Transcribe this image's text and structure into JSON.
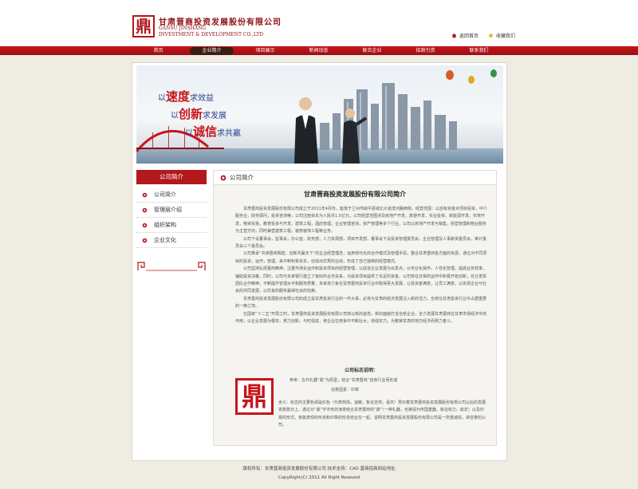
{
  "header": {
    "logo_char": "鼎",
    "company_cn": "甘肃晋商投资发展股份有限公司",
    "company_en_line1": "GANSU JINSHANG",
    "company_en_line2": "INVESTMENT & DEVELOPMENT CO.,LTD",
    "home_link": "返回首页",
    "favorite_link": "收藏我们"
  },
  "nav": {
    "items": [
      "首页",
      "企业简介",
      "项目展示",
      "新闻动态",
      "联合企业",
      "招商引资",
      "联系我们"
    ],
    "active_index": 1
  },
  "banner": {
    "slogan1_a": "以",
    "slogan1_big": "速度",
    "slogan1_b": "求效益",
    "slogan2_a": "以",
    "slogan2_big": "创新",
    "slogan2_b": "求发展",
    "slogan3_a": "以",
    "slogan3_big": "诚信",
    "slogan3_b": "求共赢"
  },
  "sidebar": {
    "title": "公司简介",
    "items": [
      {
        "label": "公司简介"
      },
      {
        "label": "管理层介绍"
      },
      {
        "label": "组织架构"
      },
      {
        "label": "企业文化"
      }
    ]
  },
  "content": {
    "section_title": "公司简介",
    "article_title": "甘肃晋商投资发展股份有限公司简介",
    "paragraphs": [
      "甘肃晋商投资发展股份有限公司成立于2011年4月份，座落于兰州市榆中县城北大道滨河路西侧，经营范围：以自有资金对项目投资，中介服务业，财务顾问，投资咨询等，公司注册资本为人民币1.5亿元，公司经营范围涉及房地产开发，旅游开发，实业投资，新能源开发，农林开发，物资贸易，教育投资与开发，建筑工程，酒店管理，企业管理咨询，资产管理等多个行业，公司以房地产开发与销售，经营管理和物业服务为主营方向，同时兼营建筑工程，装修装饰工程等业务。",
      "公司下设董事会，监事会，办公室，财务部，人力资源部，项目开发部，董事会下设投资管理委员会，企业管理及人事薪资委员会，审计委员会三个委员会。",
      "公司秉承“共谋晋商辉煌，创新共赢天下”的企业经营理念，运用现代化的合作模式及管理手段，整合甘肃晋商各方面的资源，通过对不同项目的投资，运作，管理，来不断积累资本，创造出优秀的业绩，形成了自己独特的经营模式。",
      "公司坚持弘扬晋商精神，注重市场化运作和投资项目的经营管理，以促进企业发展为出发点，以专业化操作，人性化管理，提高业务效率，辅助投资决策，同时，公司与多家银行建立了良好的合作关系，为投资项目提供了充足的资金。公司将在日常的运作中积极开拓创新，充分发挥团队合作精神，不断提升管理水平和服务质量，未来将力争在甘肃晋商投资行业中取得更大发展，让投资者满意，让员工满意，以实现企业与社会的共同发展，以优良的服务赢得社会的信赖。",
      "甘肃晋商投资发展股份有限公司的成立是甘肃投资行业的一件大事，必将为甘肃的经济发展注入新的活力，也将在甘肃投资行业中占据重要的一席之地。",
      "在国家“十二五”开局之时，甘肃晋商投资发展股份有限公司将以新的姿态，新的面貌打造全新企业，全力发展甘肃晋商在甘肃市场经济中的作用，以企业发展为根本，努力创新，与时俱进，使企业在竞争中不断壮大，增强实力，为繁荣甘肃的地方经济而努力奋斗。"
    ],
    "logo_heading": "公司标志说明：",
    "logo_ref": "参考：古代礼器“鼎”为原型，结合“甘肃晋商”自身行业而形成",
    "logo_factor": "创意因素：印章",
    "logo_char": "鼎",
    "logo_desc": "含义：标志的主要色调是红色（代表热情，温暖，象征吉祥，喜庆）预示着甘肃晋商投资发展股份有限公司以后的发展将蒸蒸日上。通过对“鼎”字字形的演变结合甘肃晋商的“鼎”（一种礼器，也被视为传国重器，象征权力，稳定）以及印章的形式，使其表现的形状和印章的形态结合在一起，说明甘肃晋商投资发展股份有限公司是一所重诚信，讲信誉的公司。"
  },
  "footer": {
    "line1": "版权所有：甘肃晋商投资发展股份有限公司    技术支持：CAD 晋商招商网站地址",
    "line2": "CopyRight(C) 2011 All Right Reseved"
  }
}
